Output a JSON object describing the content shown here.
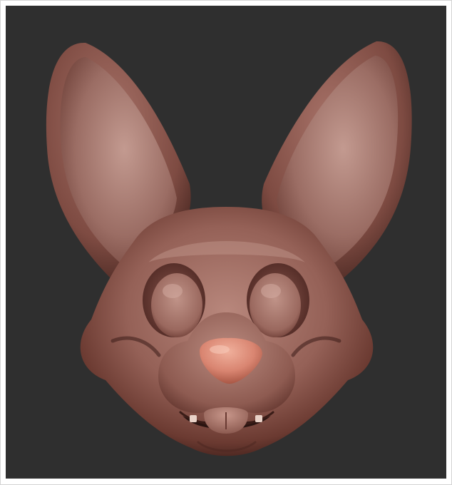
{
  "scene": {
    "subject": "sculpted-bunny-head",
    "colors": {
      "background": "#2f2f2f",
      "clay_light": "#b07e74",
      "clay_mid": "#8d5b52",
      "clay_dark": "#4a2620",
      "nose": "#e0907c",
      "frame_border": "#d4d4d4"
    }
  }
}
